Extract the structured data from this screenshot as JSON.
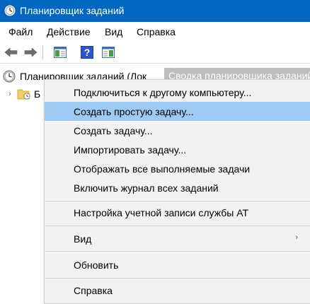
{
  "window": {
    "title": "Планировщик заданий"
  },
  "menubar": {
    "items": [
      "Файл",
      "Действие",
      "Вид",
      "Справка"
    ]
  },
  "tree": {
    "root_label": "Планировщик заданий (Лок",
    "child_label": "Б"
  },
  "right_pane": {
    "header": "Сводка планировщика заданий"
  },
  "context_menu": {
    "items": [
      "Подключиться к другому компьютеру...",
      "Создать простую задачу...",
      "Создать задачу...",
      "Импортировать задачу...",
      "Отображать все выполняемые задачи",
      "Включить журнал всех заданий",
      "Настройка учетной записи службы AT",
      "Вид",
      "Обновить",
      "Справка"
    ],
    "highlighted_index": 1,
    "submenu_arrow": "›"
  },
  "colors": {
    "titlebar": "#0067c0",
    "highlight": "#9dc9f2",
    "menu_bg": "#f2f2f2"
  }
}
